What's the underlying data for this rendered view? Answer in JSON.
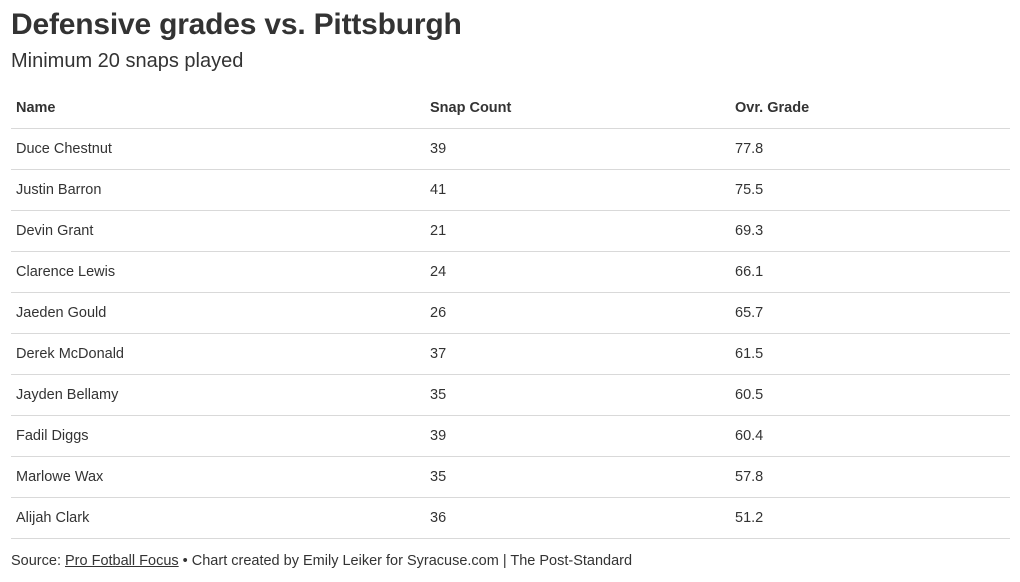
{
  "chart_data": {
    "type": "table",
    "title": "Defensive grades vs. Pittsburgh",
    "subtitle": "Minimum 20 snaps played",
    "columns": [
      "Name",
      "Snap Count",
      "Ovr. Grade"
    ],
    "rows": [
      [
        "Duce Chestnut",
        "39",
        "77.8"
      ],
      [
        "Justin Barron",
        "41",
        "75.5"
      ],
      [
        "Devin Grant",
        "21",
        "69.3"
      ],
      [
        "Clarence Lewis",
        "24",
        "66.1"
      ],
      [
        "Jaeden Gould",
        "26",
        "65.7"
      ],
      [
        "Derek McDonald",
        "37",
        "61.5"
      ],
      [
        "Jayden Bellamy",
        "35",
        "60.5"
      ],
      [
        "Fadil Diggs",
        "39",
        "60.4"
      ],
      [
        "Marlowe Wax",
        "35",
        "57.8"
      ],
      [
        "Alijah Clark",
        "36",
        "51.2"
      ]
    ]
  },
  "footer": {
    "source_prefix": "Source: ",
    "source_link": "Pro Fotball Focus",
    "credit": " • Chart created by Emily Leiker for Syracuse.com | The Post-Standard"
  }
}
